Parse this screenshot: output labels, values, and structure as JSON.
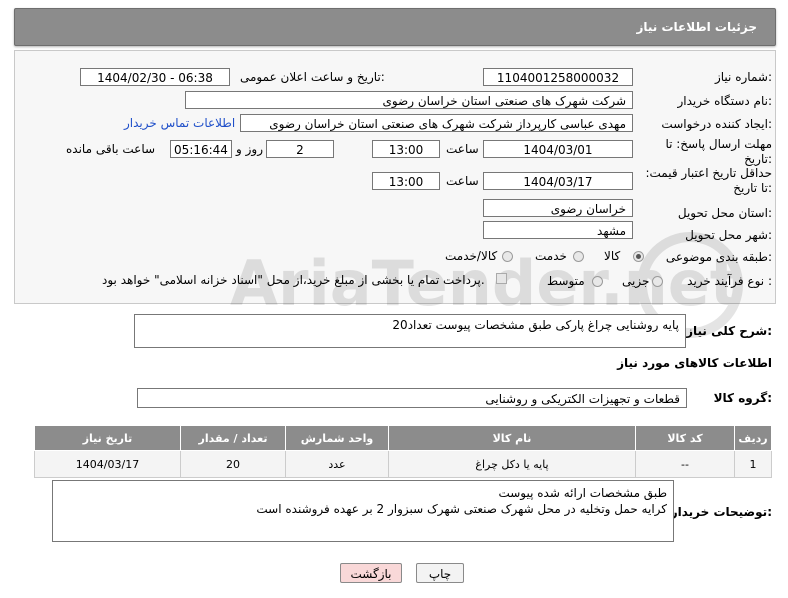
{
  "header": {
    "title": "جزئیات اطلاعات نیاز"
  },
  "form": {
    "need_number_label": "شماره نیاز:",
    "need_number": "1104001258000032",
    "announce_label": "تاریخ و ساعت اعلان عمومی:",
    "announce_value": "1404/02/30 - 06:38",
    "buyer_org_label": "نام دستگاه خریدار:",
    "buyer_org": "شرکت شهرک های صنعتی استان خراسان رضوی",
    "creator_label": "ایجاد کننده درخواست:",
    "creator": "مهدی عباسی کارپرداز شرکت شهرک های صنعتی استان خراسان رضوی",
    "contact_link": "اطلاعات تماس خریدار",
    "deadline_label": "مهلت ارسال پاسخ: تا تاریخ:",
    "deadline_date": "1404/03/01",
    "time_label": "ساعت",
    "deadline_time": "13:00",
    "days": "2",
    "days_label": "روز و",
    "remaining": "05:16:44",
    "remaining_label": "ساعت باقی مانده",
    "validity_label": "حداقل تاریخ اعتبار قیمت: تا تاریخ:",
    "validity_date": "1404/03/17",
    "validity_time": "13:00",
    "province_label": "استان محل تحویل:",
    "province": "خراسان رضوی",
    "city_label": "شهر محل تحویل:",
    "city": "مشهد",
    "category_label": "طبقه بندی موضوعی:",
    "category_options": [
      "کالا",
      "خدمت",
      "کالا/خدمت"
    ],
    "process_label": "نوع فرآیند خرید :",
    "process_options": [
      "جزیی",
      "متوسط"
    ],
    "payment_note": "پرداخت تمام یا بخشی از مبلغ خرید،از محل \"اسناد خزانه اسلامی\" خواهد بود."
  },
  "description": {
    "label": "شرح کلی نیاز:",
    "text": "پایه روشنایی چراغ پارکی طبق مشخصات پیوست      تعداد20"
  },
  "goods": {
    "section_title": "اطلاعات کالاهای مورد نیاز",
    "group_label": "گروه کالا:",
    "group_value": "قطعات و تجهیزات الکتریکی و روشنایی",
    "columns": [
      "ردیف",
      "کد کالا",
      "نام کالا",
      "واحد شمارش",
      "تعداد / مقدار",
      "تاریخ نیاز"
    ],
    "rows": [
      {
        "row": "1",
        "code": "--",
        "name": "پایه یا دکل چراغ",
        "unit": "عدد",
        "qty": "20",
        "date": "1404/03/17"
      }
    ]
  },
  "buyer_notes": {
    "label": "توضیحات خریدار:",
    "line1": "طبق مشخصات ارائه شده پیوست",
    "line2": "کرایه حمل وتخلیه در محل شهرک صنعتی شهرک سبزوار 2 بر عهده فروشنده است"
  },
  "buttons": {
    "print": "چاپ",
    "back": "بازگشت"
  },
  "watermark": {
    "text": "AriaTender.net"
  },
  "colors": {
    "header_bg": "#8c8c8c",
    "link": "#1f4fc9",
    "back_bg": "#f9d8d8"
  }
}
